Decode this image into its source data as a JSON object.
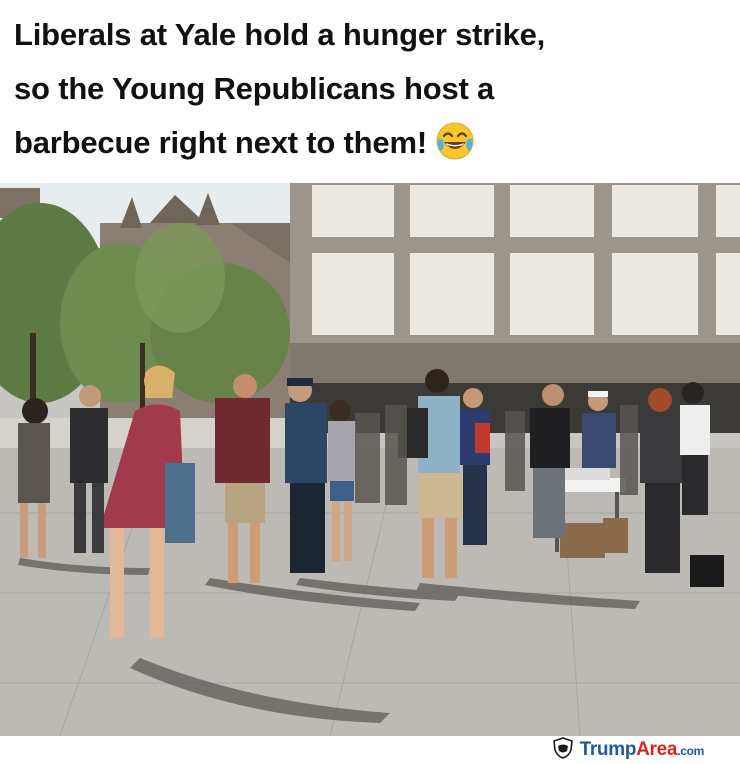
{
  "post": {
    "caption_lines": [
      "Liberals at Yale hold a hunger strike,",
      "so the Young Republicans host a",
      "barbecue right next to them!"
    ],
    "caption_emoji": "face-with-tears-of-joy-icon"
  },
  "photo": {
    "icon": "photo-of-campus-plaza"
  },
  "watermark": {
    "brand_part1": "Trump",
    "brand_part2": "Area",
    "brand_suffix": ".com",
    "logo_icon": "shield-logo-icon"
  },
  "colors": {
    "brand_blue": "#1c5aa8",
    "brand_red": "#d9271d",
    "caption_text": "#111111"
  }
}
